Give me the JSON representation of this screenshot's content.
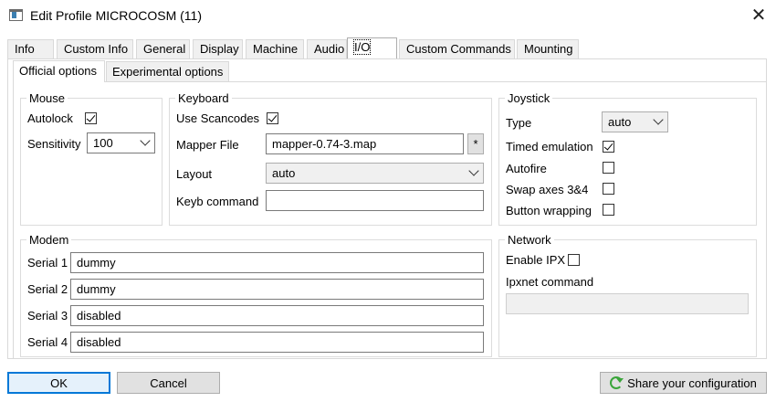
{
  "window": {
    "title": "Edit Profile MICROCOSM (11)"
  },
  "tabs": [
    "Info",
    "Custom Info",
    "General",
    "Display",
    "Machine",
    "Audio",
    "I/O",
    "Custom Commands",
    "Mounting"
  ],
  "subtabs": [
    "Official options",
    "Experimental options"
  ],
  "mouse": {
    "legend": "Mouse",
    "autolock_label": "Autolock",
    "autolock_checked": true,
    "sensitivity_label": "Sensitivity",
    "sensitivity_value": "100"
  },
  "keyboard": {
    "legend": "Keyboard",
    "use_scancodes_label": "Use Scancodes",
    "use_scancodes_checked": true,
    "mapper_file_label": "Mapper File",
    "mapper_file_value": "mapper-0.74-3.map",
    "mapper_browse_label": "*",
    "layout_label": "Layout",
    "layout_value": "auto",
    "keyb_command_label": "Keyb command",
    "keyb_command_value": ""
  },
  "joystick": {
    "legend": "Joystick",
    "type_label": "Type",
    "type_value": "auto",
    "timed_emulation_label": "Timed emulation",
    "timed_emulation_checked": true,
    "autofire_label": "Autofire",
    "autofire_checked": false,
    "swap_axes_label": "Swap axes 3&4",
    "swap_axes_checked": false,
    "button_wrapping_label": "Button wrapping",
    "button_wrapping_checked": false
  },
  "modem": {
    "legend": "Modem",
    "serials": [
      {
        "label": "Serial 1",
        "value": "dummy"
      },
      {
        "label": "Serial 2",
        "value": "dummy"
      },
      {
        "label": "Serial 3",
        "value": "disabled"
      },
      {
        "label": "Serial 4",
        "value": "disabled"
      }
    ]
  },
  "network": {
    "legend": "Network",
    "enable_ipx_label": "Enable IPX",
    "enable_ipx_checked": false,
    "ipxnet_command_label": "Ipxnet command",
    "ipxnet_command_value": ""
  },
  "buttons": {
    "ok": "OK",
    "cancel": "Cancel",
    "share": "Share your configuration"
  },
  "colors": {
    "accent": "#0078d7",
    "share_icon": "#3aa53a"
  }
}
